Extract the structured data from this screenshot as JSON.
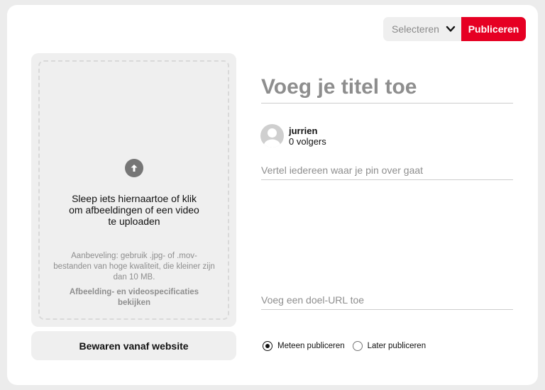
{
  "header": {
    "board_select": {
      "value": "Selecteren"
    },
    "publish_label": "Publiceren"
  },
  "upload": {
    "drop_line1": "Sleep iets hiernaartoe of klik",
    "drop_line2": "om afbeeldingen of een video",
    "drop_line3": "te uploaden",
    "recommend_line1": "Aanbeveling: gebruik .jpg- of .mov-",
    "recommend_line2": "bestanden van hoge kwaliteit, die kleiner zijn",
    "recommend_line3": "dan 10 MB.",
    "specs_line1": "Afbeelding- en videospecificaties",
    "specs_line2": "bekijken",
    "save_from_site_label": "Bewaren vanaf website"
  },
  "form": {
    "title_placeholder": "Voeg je titel toe",
    "title_value": "",
    "user": {
      "name": "jurrien",
      "followers": "0 volgers"
    },
    "description_placeholder": "Vertel iedereen waar je pin over gaat",
    "description_value": "",
    "url_placeholder": "Voeg een doel-URL toe",
    "url_value": ""
  },
  "publish_options": {
    "selected": "now",
    "now_label": "Meteen publiceren",
    "later_label": "Later publiceren"
  },
  "icons": {
    "upload": "upload-arrow-icon",
    "chevron": "chevron-down-icon",
    "avatar": "user-avatar-icon"
  },
  "colors": {
    "accent": "#e60023",
    "panel": "#efefef",
    "muted_text": "#8e8e8e"
  }
}
